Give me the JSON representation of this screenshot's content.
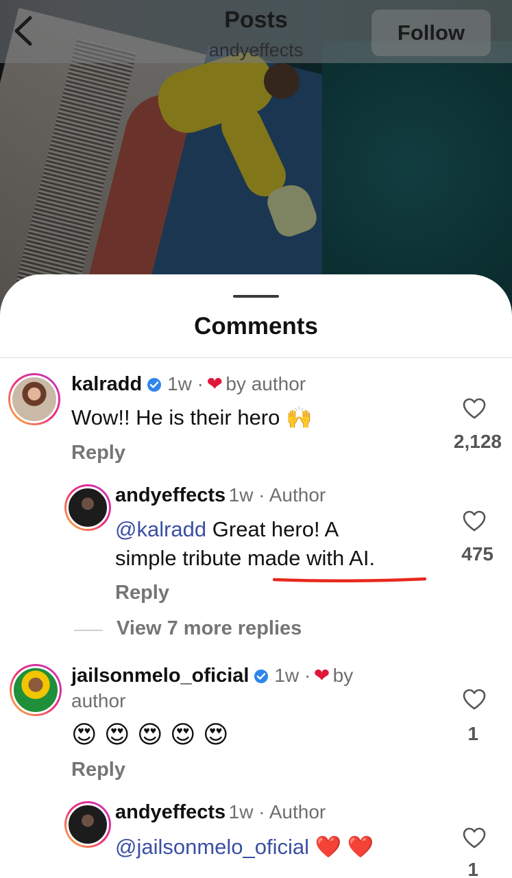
{
  "header": {
    "title": "Posts",
    "subtitle": "andyeffects",
    "follow_label": "Follow"
  },
  "sheet": {
    "title": "Comments"
  },
  "comments": [
    {
      "username": "kalradd",
      "time": "1w ·",
      "liked_by": "by author",
      "text": "Wow!! He is their hero",
      "emoji": "🙌",
      "reply_label": "Reply",
      "likes": "2,128",
      "replies": [
        {
          "username": "andyeffects",
          "time_role": "1w · Author",
          "mention": "@kalradd",
          "text_line1": "Great hero! A",
          "text_line2": "simple tribute made with AI.",
          "reply_label": "Reply",
          "likes": "475"
        }
      ],
      "view_more": "View 7 more replies"
    },
    {
      "username": "jailsonmelo_oficial",
      "time": "1w ·",
      "liked_by_1": "by",
      "liked_by_2": "author",
      "emojis": [
        "😍",
        "😍",
        "😍",
        "😍",
        "😍"
      ],
      "reply_label": "Reply",
      "likes": "1",
      "replies": [
        {
          "username": "andyeffects",
          "time_role": "1w · Author",
          "mention": "@jailsonmelo_oficial",
          "hearts": "❤️ ❤️",
          "likes": "1"
        }
      ]
    }
  ],
  "colors": {
    "mention": "#3b4fa3",
    "heart_red": "#e0173a",
    "annotation_underline": "#e8281e",
    "verified_blue": "#2f86ea"
  }
}
